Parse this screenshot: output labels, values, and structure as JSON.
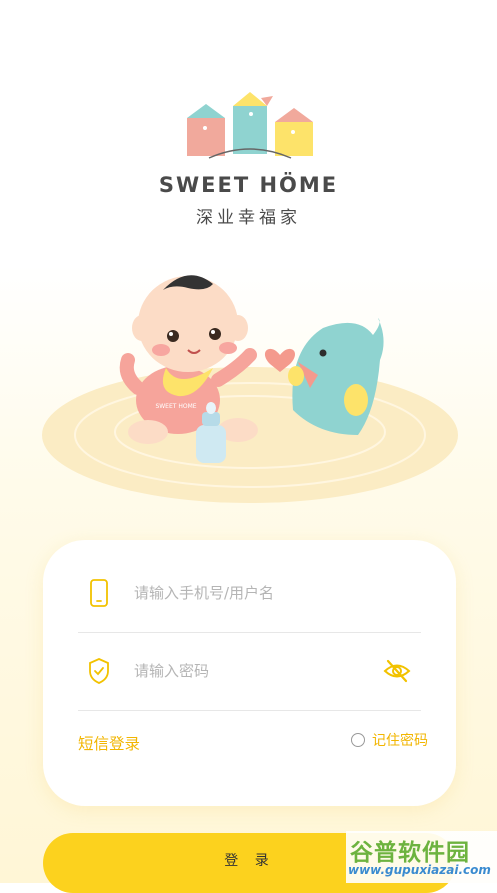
{
  "brand": {
    "name_en": "SWEET HÖME",
    "name_cn": "深业幸福家"
  },
  "login_form": {
    "phone_placeholder": "请输入手机号/用户名",
    "password_placeholder": "请输入密码",
    "sms_login_label": "短信登录",
    "remember_password_label": "记住密码",
    "login_button_label": "登 录"
  },
  "illustration": {
    "bib_text": "SWEET HOME"
  },
  "watermark": {
    "cn": "谷普软件园",
    "en": "www.gupuxiazai.com"
  },
  "colors": {
    "accent": "#fcd21e",
    "accent_text": "#f2b500",
    "placeholder": "#b5b5b5"
  }
}
